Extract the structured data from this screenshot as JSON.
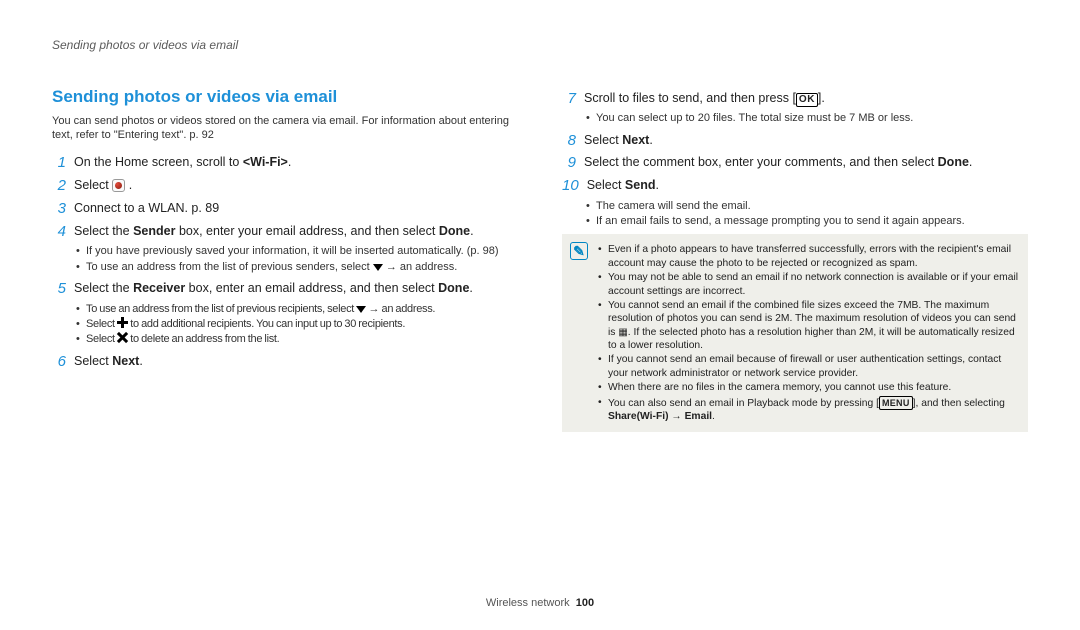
{
  "running_head": "Sending photos or videos via email",
  "section_title": "Sending photos or videos via email",
  "intro": "You can send photos or videos stored on the camera via email. For information about entering text, refer to \"Entering text\". p. 92",
  "left_steps": {
    "s1": {
      "num": "1",
      "text_a": "On the Home screen, scroll to ",
      "bold": "<Wi-Fi>",
      "text_b": "."
    },
    "s2": {
      "num": "2",
      "text": "Select "
    },
    "s3": {
      "num": "3",
      "text": "Connect to a WLAN. p. 89"
    },
    "s4": {
      "num": "4",
      "pre": "Select the ",
      "b1": "Sender",
      "mid": " box, enter your email address, and then select ",
      "b2": "Done",
      "post": ".",
      "bul1": "If you have previously saved your information, it will be inserted automatically. (p. 98)",
      "bul2_a": "To use an address from the list of previous senders, select ",
      "bul2_b": " → an address."
    },
    "s5": {
      "num": "5",
      "pre": "Select the ",
      "b1": "Receiver",
      "mid": " box, enter an email address, and then select ",
      "b2": "Done",
      "post": ".",
      "bul1_a": "To use an address from the list of previous recipients, select ",
      "bul1_b": " → an address.",
      "bul2_a": "Select ",
      "bul2_b": " to add additional recipients. You can input up to 30 recipients.",
      "bul3_a": "Select ",
      "bul3_b": " to delete an address from the list."
    },
    "s6": {
      "num": "6",
      "pre": "Select ",
      "b1": "Next",
      "post": "."
    }
  },
  "right_steps": {
    "s7": {
      "num": "7",
      "pre": "Scroll to files to send, and then press [",
      "post": "].",
      "bul1": "You can select up to 20 files. The total size must be 7 MB or less."
    },
    "s8": {
      "num": "8",
      "pre": "Select ",
      "b1": "Next",
      "post": "."
    },
    "s9": {
      "num": "9",
      "pre": "Select the comment box, enter your comments, and then select ",
      "b1": "Done",
      "post": "."
    },
    "s10": {
      "num": "10",
      "pre": "Select ",
      "b1": "Send",
      "post": ".",
      "bul1": "The camera will send the email.",
      "bul2": "If an email fails to send, a message prompting you to send it again appears."
    }
  },
  "notes": {
    "n1": "Even if a photo appears to have transferred successfully, errors with the recipient's email account may cause the photo to be rejected or recognized as spam.",
    "n2": "You may not be able to send an email if no network connection is available or if your email account settings are incorrect.",
    "n3_a": "You cannot send an email if the combined file sizes exceed the 7MB. The maximum resolution of photos you can send is 2M. The maximum resolution of videos you can send is ",
    "n3_b": ". If the selected photo has a resolution higher than 2M, it will be automatically resized to a lower resolution.",
    "n4": "If you cannot send an email because of firewall or user authentication settings, contact your network administrator or network service provider.",
    "n5": "When there are no files in the camera memory, you cannot use this feature.",
    "n6_a": "You can also send an email in Playback mode by pressing [",
    "n6_b": "], and then selecting ",
    "n6_bold": "Share(Wi-Fi) → Email",
    "n6_c": "."
  },
  "footer": {
    "label": "Wireless network",
    "page": "100"
  }
}
